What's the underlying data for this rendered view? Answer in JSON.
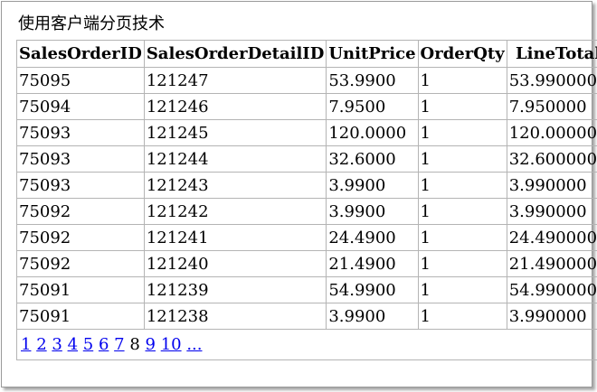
{
  "title": "使用客户端分页技术",
  "columns": [
    "SalesOrderID",
    "SalesOrderDetailID",
    "UnitPrice",
    "OrderQty",
    "LineTotal"
  ],
  "rows": [
    [
      "75095",
      "121247",
      "53.9900",
      "1",
      "53.990000"
    ],
    [
      "75094",
      "121246",
      "7.9500",
      "1",
      "7.950000"
    ],
    [
      "75093",
      "121245",
      "120.0000",
      "1",
      "120.000000"
    ],
    [
      "75093",
      "121244",
      "32.6000",
      "1",
      "32.600000"
    ],
    [
      "75093",
      "121243",
      "3.9900",
      "1",
      "3.990000"
    ],
    [
      "75092",
      "121242",
      "3.9900",
      "1",
      "3.990000"
    ],
    [
      "75092",
      "121241",
      "24.4900",
      "1",
      "24.490000"
    ],
    [
      "75092",
      "121240",
      "21.4900",
      "1",
      "21.490000"
    ],
    [
      "75091",
      "121239",
      "54.9900",
      "1",
      "54.990000"
    ],
    [
      "75091",
      "121238",
      "3.9900",
      "1",
      "3.990000"
    ]
  ],
  "pager": {
    "pages": [
      "1",
      "2",
      "3",
      "4",
      "5",
      "6",
      "7",
      "8",
      "9",
      "10",
      "..."
    ],
    "current": "8"
  },
  "colors": {
    "link": "#0000ee",
    "border": "#b4b4b4",
    "frame_border": "#9a9a9a"
  }
}
